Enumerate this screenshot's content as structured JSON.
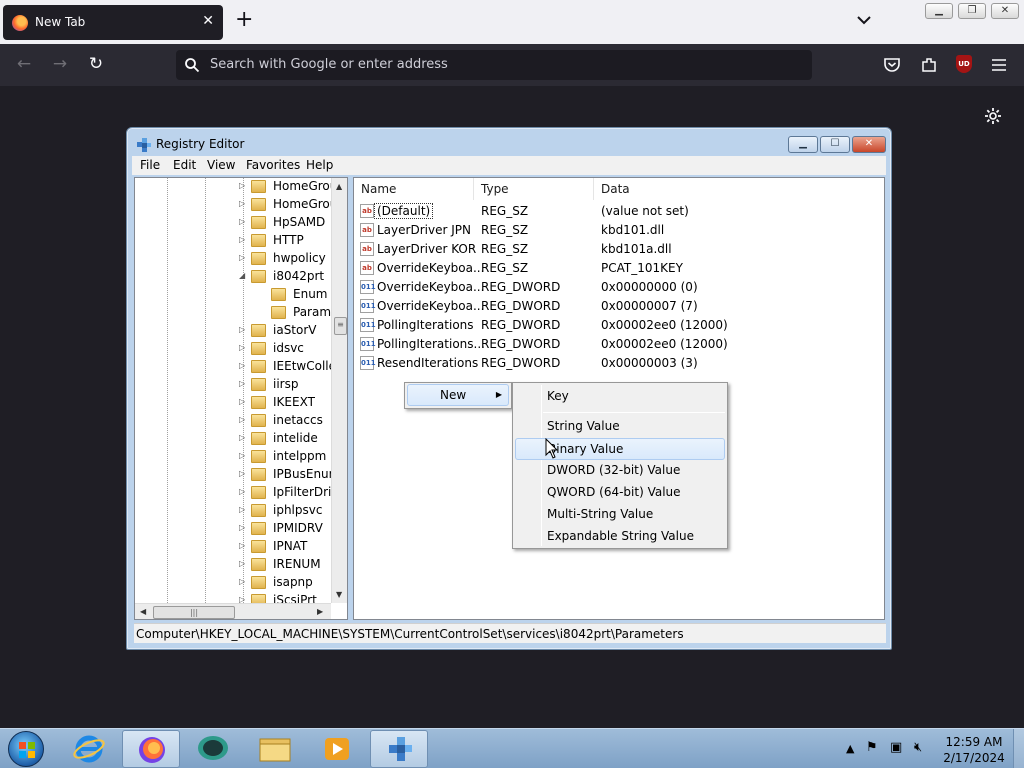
{
  "browser": {
    "tab_title": "New Tab",
    "url_placeholder": "Search with Google or enter address",
    "ublock_label": "UD"
  },
  "regedit": {
    "window_title": "Registry Editor",
    "menu": [
      "File",
      "Edit",
      "View",
      "Favorites",
      "Help"
    ],
    "tree": [
      {
        "label": "HomeGrou",
        "level": 0,
        "exp": "▷"
      },
      {
        "label": "HomeGrou",
        "level": 0,
        "exp": "▷"
      },
      {
        "label": "HpSAMD",
        "level": 0,
        "exp": "▷"
      },
      {
        "label": "HTTP",
        "level": 0,
        "exp": "▷"
      },
      {
        "label": "hwpolicy",
        "level": 0,
        "exp": "▷"
      },
      {
        "label": "i8042prt",
        "level": 0,
        "exp": "◢"
      },
      {
        "label": "Enum",
        "level": 1,
        "exp": ""
      },
      {
        "label": "Parame",
        "level": 1,
        "exp": ""
      },
      {
        "label": "iaStorV",
        "level": 0,
        "exp": "▷"
      },
      {
        "label": "idsvc",
        "level": 0,
        "exp": "▷"
      },
      {
        "label": "IEEtwColle",
        "level": 0,
        "exp": "▷"
      },
      {
        "label": "iirsp",
        "level": 0,
        "exp": "▷"
      },
      {
        "label": "IKEEXT",
        "level": 0,
        "exp": "▷"
      },
      {
        "label": "inetaccs",
        "level": 0,
        "exp": "▷"
      },
      {
        "label": "intelide",
        "level": 0,
        "exp": "▷"
      },
      {
        "label": "intelppm",
        "level": 0,
        "exp": "▷"
      },
      {
        "label": "IPBusEnum",
        "level": 0,
        "exp": "▷"
      },
      {
        "label": "IpFilterDriv",
        "level": 0,
        "exp": "▷"
      },
      {
        "label": "iphlpsvc",
        "level": 0,
        "exp": "▷"
      },
      {
        "label": "IPMIDRV",
        "level": 0,
        "exp": "▷"
      },
      {
        "label": "IPNAT",
        "level": 0,
        "exp": "▷"
      },
      {
        "label": "IRENUM",
        "level": 0,
        "exp": "▷"
      },
      {
        "label": "isapnp",
        "level": 0,
        "exp": "▷"
      },
      {
        "label": "iScsiPrt",
        "level": 0,
        "exp": "▷"
      }
    ],
    "columns": [
      "Name",
      "Type",
      "Data"
    ],
    "values": [
      {
        "icon": "sz",
        "name": "(Default)",
        "type": "REG_SZ",
        "data": "(value not set)"
      },
      {
        "icon": "sz",
        "name": "LayerDriver JPN",
        "type": "REG_SZ",
        "data": "kbd101.dll"
      },
      {
        "icon": "sz",
        "name": "LayerDriver KOR",
        "type": "REG_SZ",
        "data": "kbd101a.dll"
      },
      {
        "icon": "sz",
        "name": "OverrideKeyboa...",
        "type": "REG_SZ",
        "data": "PCAT_101KEY"
      },
      {
        "icon": "bin",
        "name": "OverrideKeyboa...",
        "type": "REG_DWORD",
        "data": "0x00000000 (0)"
      },
      {
        "icon": "bin",
        "name": "OverrideKeyboa...",
        "type": "REG_DWORD",
        "data": "0x00000007 (7)"
      },
      {
        "icon": "bin",
        "name": "PollingIterations",
        "type": "REG_DWORD",
        "data": "0x00002ee0 (12000)"
      },
      {
        "icon": "bin",
        "name": "PollingIterations...",
        "type": "REG_DWORD",
        "data": "0x00002ee0 (12000)"
      },
      {
        "icon": "bin",
        "name": "ResendIterations",
        "type": "REG_DWORD",
        "data": "0x00000003 (3)"
      }
    ],
    "status_path": "Computer\\HKEY_LOCAL_MACHINE\\SYSTEM\\CurrentControlSet\\services\\i8042prt\\Parameters"
  },
  "context_menu": {
    "new_label": "New",
    "submenu": [
      "Key",
      "String Value",
      "Binary Value",
      "DWORD (32-bit) Value",
      "QWORD (64-bit) Value",
      "Multi-String Value",
      "Expandable String Value"
    ],
    "highlighted": "Binary Value"
  },
  "taskbar": {
    "time": "12:59 AM",
    "date": "2/17/2024",
    "icons": [
      "internet-explorer-icon",
      "firefox-icon",
      "chat-icon",
      "file-explorer-icon",
      "media-player-icon",
      "registry-editor-icon"
    ]
  },
  "colors": {
    "firefox_dark": "#1f1e25",
    "toolbar": "#2b2a33",
    "taskbar": "#8fb0d0"
  }
}
